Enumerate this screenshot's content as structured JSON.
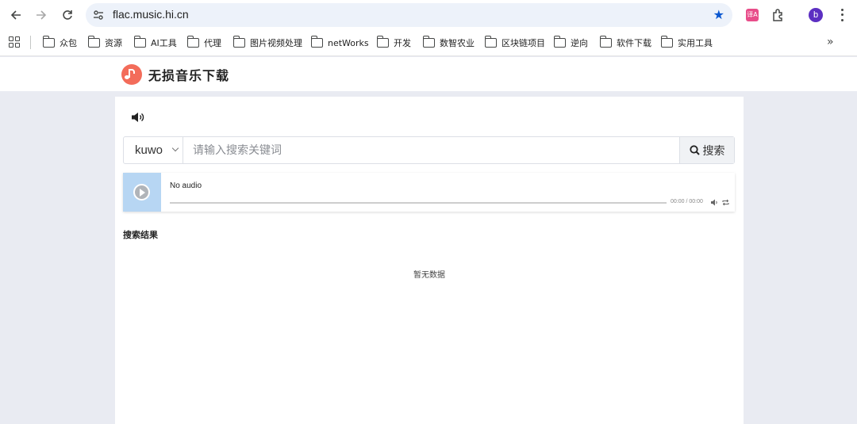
{
  "browser": {
    "url": "flac.music.hi.cn",
    "avatar_letter": "b",
    "translate_badge": "译A",
    "bookmarks": [
      "众包",
      "资源",
      "AI工具",
      "代理",
      "图片视频处理",
      "netWorks",
      "开发",
      "数智农业",
      "区块链项目",
      "逆向",
      "软件下载",
      "实用工具"
    ],
    "more_label": "»"
  },
  "site": {
    "title": "无损音乐下载"
  },
  "search": {
    "source": "kuwo",
    "placeholder": "请输入搜索关键词",
    "button_label": "搜索"
  },
  "player": {
    "title": "No audio",
    "time": "00:00 / 00:00"
  },
  "results": {
    "heading": "搜索结果",
    "empty_text": "暂无数据"
  },
  "colors": {
    "accent": "#f36c5a",
    "star": "#0b57d0",
    "avatar": "#5c2fc2",
    "page_bg": "#e9ebf2",
    "player_cover": "#b7d6f3"
  }
}
